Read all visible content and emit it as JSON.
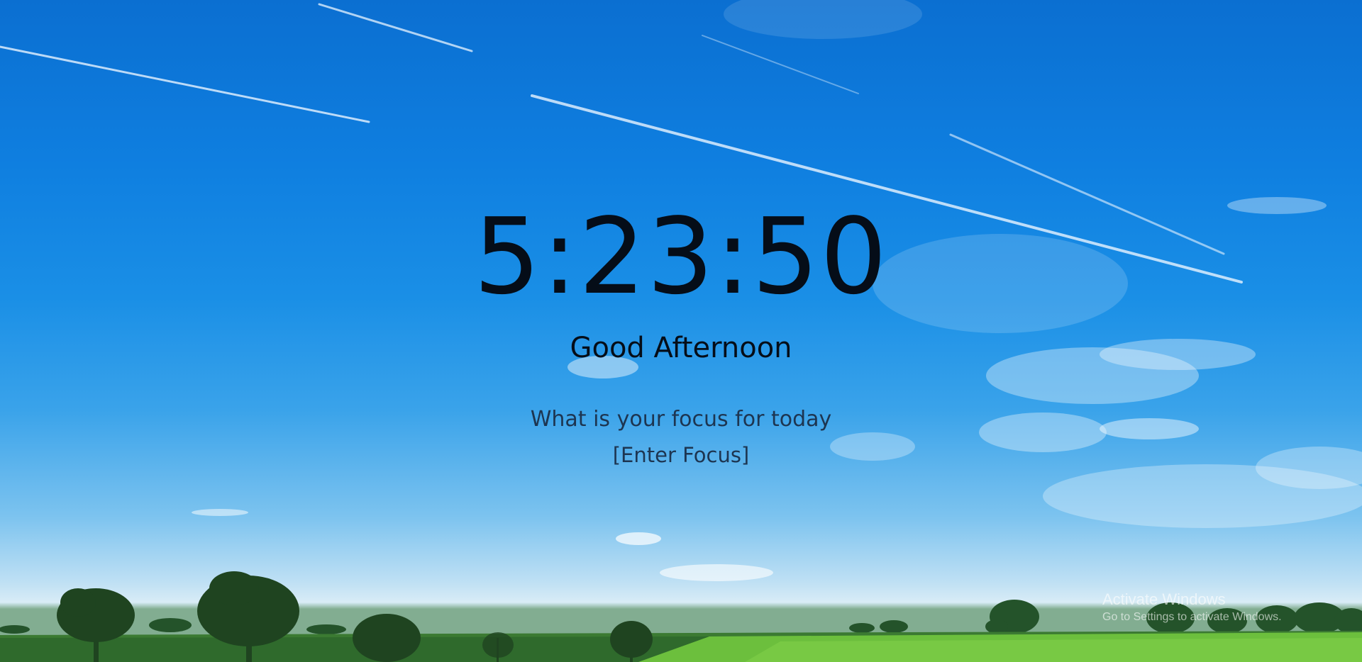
{
  "clock": {
    "time": "5:23:50"
  },
  "greeting": {
    "text": "Good Afternoon"
  },
  "focus": {
    "question": "What is your focus for today",
    "input_value": "[Enter Focus]"
  },
  "os_watermark": {
    "title": "Activate Windows",
    "subtitle": "Go to Settings to activate Windows."
  },
  "colors": {
    "sky_top": "#0b6fd1",
    "sky_horizon": "#d9ecf6",
    "grass_dark": "#2f6f2d",
    "grass_light": "#6fc040",
    "text_primary": "#050d18",
    "text_secondary": "#1d3551"
  }
}
